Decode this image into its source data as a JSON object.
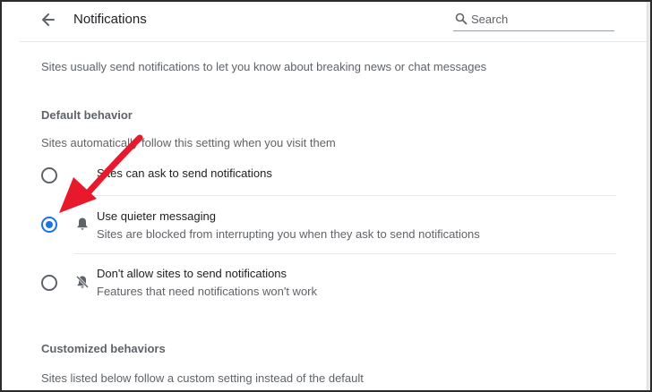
{
  "header": {
    "title": "Notifications",
    "back_icon": "arrow-left-icon",
    "search": {
      "placeholder": "Search",
      "value": "",
      "icon": "search-icon"
    }
  },
  "intro": "Sites usually send notifications to let you know about breaking news or chat messages",
  "default_behavior": {
    "title": "Default behavior",
    "description": "Sites automatically follow this setting when you visit them",
    "options": [
      {
        "label": "Sites can ask to send notifications",
        "sublabel": "",
        "selected": false,
        "icon": ""
      },
      {
        "label": "Use quieter messaging",
        "sublabel": "Sites are blocked from interrupting you when they ask to send notifications",
        "selected": true,
        "icon": "bell-icon"
      },
      {
        "label": "Don't allow sites to send notifications",
        "sublabel": "Features that need notifications won't work",
        "selected": false,
        "icon": "bell-off-icon"
      }
    ]
  },
  "customized_behaviors": {
    "title": "Customized behaviors",
    "description": "Sites listed below follow a custom setting instead of the default"
  },
  "colors": {
    "accent": "#1a73e8",
    "annotation_arrow": "#e8192c"
  }
}
